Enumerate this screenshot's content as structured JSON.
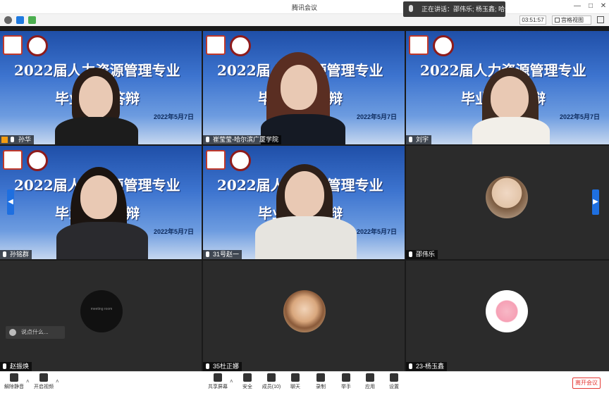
{
  "window": {
    "title": "腾讯会议"
  },
  "infobar": {
    "timer": "03:51:57",
    "view_label": "宫格视图"
  },
  "speaking": {
    "text": "正在讲话：邵伟乐; 杨玉鑫; 哈尔..."
  },
  "slide": {
    "title": "2022届人力资源管理专业",
    "subtitle": "毕业论文答辩",
    "date": "2022年5月7日"
  },
  "tiles": [
    {
      "name": "孙华"
    },
    {
      "name": "崔莹莹-哈尔滨广厦学院"
    },
    {
      "name": "刘宇"
    },
    {
      "name": "孙铭群"
    },
    {
      "name": "31号赵一"
    },
    {
      "name": "邵伟乐"
    },
    {
      "name": "赵振焕"
    },
    {
      "name": "35杜正娜"
    },
    {
      "name": "23-杨玉鑫"
    }
  ],
  "avatar_labels": {
    "meeting_room": "meeting room"
  },
  "chat": {
    "placeholder": "说点什么..."
  },
  "toolbar": {
    "unmute": "解除静音",
    "video": "开启视频",
    "share": "共享屏幕",
    "security": "安全",
    "members": "成员(10)",
    "chat": "聊天",
    "record": "录制",
    "raise_hand": "举手",
    "apps": "应用",
    "settings": "设置",
    "leave": "离开会议"
  }
}
